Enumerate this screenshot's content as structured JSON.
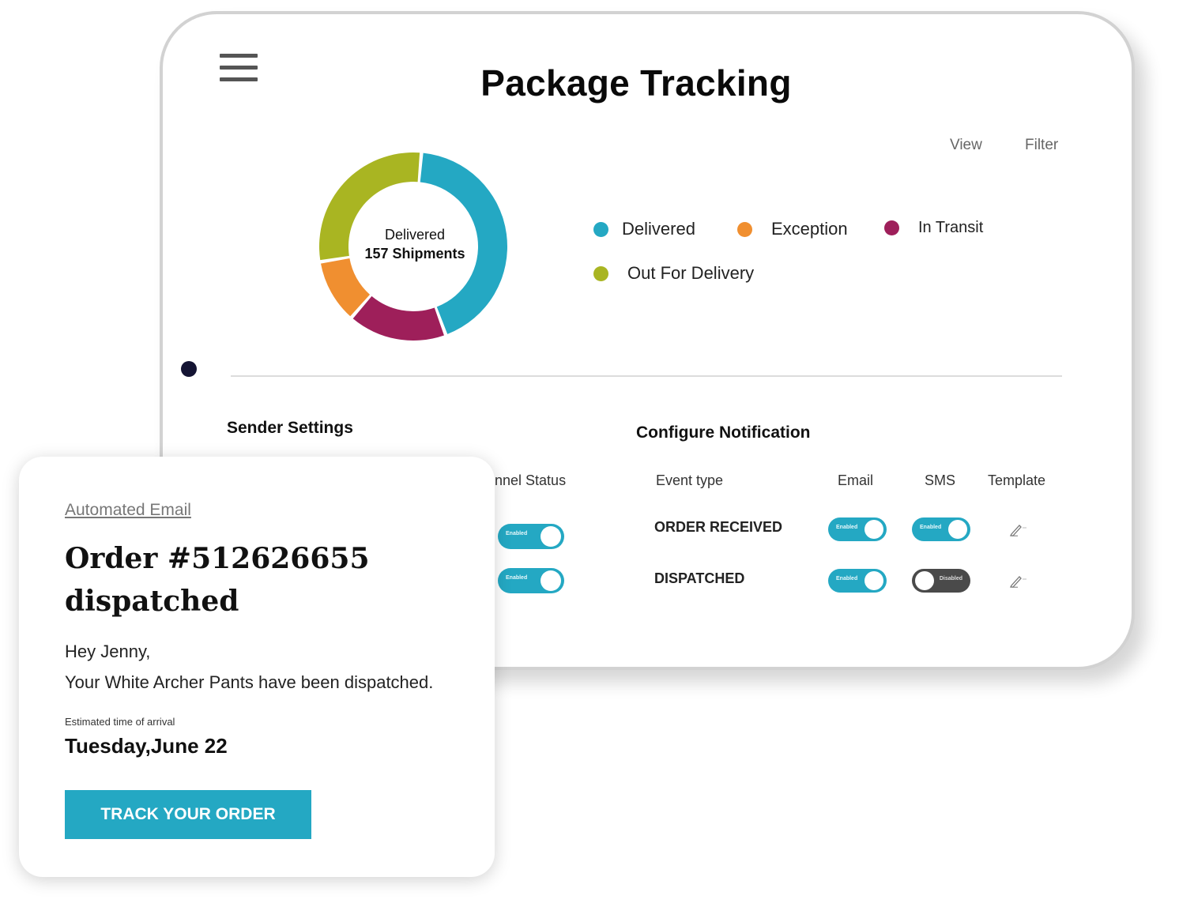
{
  "tablet": {
    "title": "Package Tracking",
    "view_label": "View",
    "filter_label": "Filter",
    "donut": {
      "center_line1": "Delivered",
      "center_line2": "157 Shipments"
    },
    "legend": [
      {
        "label": "Delivered",
        "color": "#24a8c3"
      },
      {
        "label": "Exception",
        "color": "#f08f30"
      },
      {
        "label": "In Transit",
        "color": "#9e1f5a"
      },
      {
        "label": "Out For Delivery",
        "color": "#a9b522"
      }
    ],
    "sender_settings": {
      "title": "Sender Settings",
      "channel_status_header": "annel Status",
      "toggles": [
        {
          "state": "on",
          "label": "Enabled"
        },
        {
          "state": "on",
          "label": "Enabled"
        }
      ]
    },
    "configure_notification": {
      "title": "Configure Notification",
      "headers": {
        "event_type": "Event type",
        "email": "Email",
        "sms": "SMS",
        "template": "Template"
      },
      "rows": [
        {
          "event": "ORDER RECEIVED",
          "email": {
            "state": "on",
            "label": "Enabled"
          },
          "sms": {
            "state": "on",
            "label": "Enabled"
          },
          "template_icon": "edit-icon"
        },
        {
          "event": "DISPATCHED",
          "email": {
            "state": "on",
            "label": "Enabled"
          },
          "sms": {
            "state": "off",
            "label": "Disabled"
          },
          "template_icon": "edit-icon"
        }
      ]
    }
  },
  "email_card": {
    "link": "Automated Email",
    "order_line1": "Order #512626655",
    "order_line2": "dispatched",
    "greeting": "Hey Jenny,",
    "message": "Your White Archer Pants have been dispatched.",
    "eta_label": "Estimated time of arrival",
    "eta_date": "Tuesday,June 22",
    "button_label": "TRACK YOUR ORDER"
  },
  "chart_data": {
    "type": "pie",
    "title": "",
    "categories": [
      "Delivered",
      "In Transit",
      "Exception",
      "Out For Delivery"
    ],
    "values": [
      43,
      17,
      11,
      29
    ],
    "colors": [
      "#24a8c3",
      "#9e1f5a",
      "#f08f30",
      "#a9b522"
    ]
  }
}
